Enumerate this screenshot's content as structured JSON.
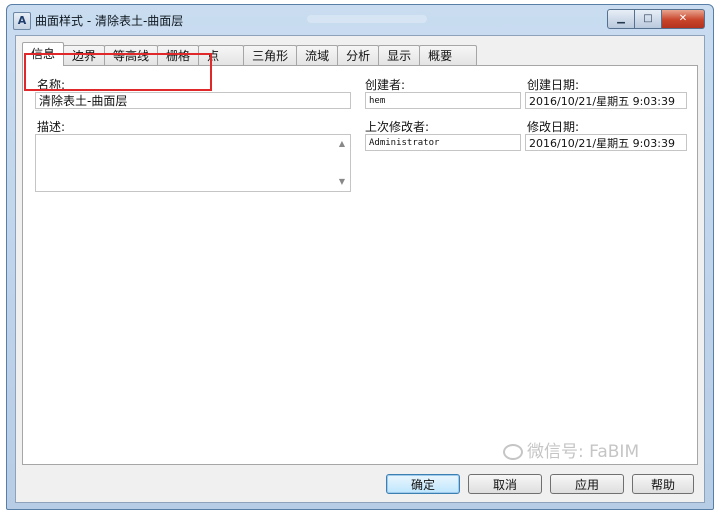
{
  "window": {
    "title": "曲面样式 - 清除表土-曲面层",
    "app_icon_glyph": "A",
    "minimize_glyph": "▁",
    "maximize_glyph": "□",
    "close_glyph": "✕"
  },
  "tabs": [
    {
      "label": "信息",
      "active": true
    },
    {
      "label": "边界"
    },
    {
      "label": "等高线"
    },
    {
      "label": "栅格"
    },
    {
      "label": "点"
    },
    {
      "label": "三角形"
    },
    {
      "label": "流域"
    },
    {
      "label": "分析"
    },
    {
      "label": "显示"
    },
    {
      "label": "概要"
    }
  ],
  "info": {
    "name_label": "名称:",
    "name_value": "清除表土-曲面层",
    "desc_label": "描述:",
    "desc_value": "",
    "creator_label": "创建者:",
    "creator_value": "hem",
    "created_date_label": "创建日期:",
    "created_date_value": "2016/10/21/星期五 9:03:39",
    "last_modified_by_label": "上次修改者:",
    "last_modified_by_value": "Administrator",
    "modified_date_label": "修改日期:",
    "modified_date_value": "2016/10/21/星期五 9:03:39"
  },
  "buttons": {
    "ok": "确定",
    "cancel": "取消",
    "apply": "应用",
    "help": "帮助"
  },
  "watermark": "微信号: FaBIM",
  "colors": {
    "highlight_box": "#e0282b",
    "title_gradient_top": "#c9dcf0",
    "close_button": "#c8452b"
  }
}
